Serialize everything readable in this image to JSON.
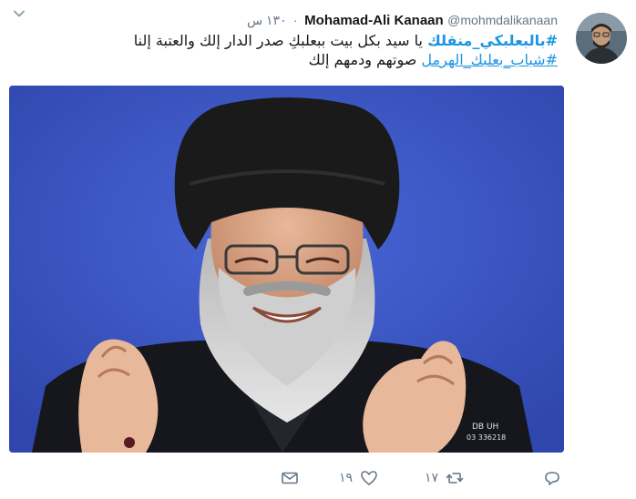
{
  "tweet": {
    "author_name": "Mohamad-Ali Kanaan",
    "author_handle": "@mohmdalikanaan",
    "separator": "·",
    "time": "١٣٠ س",
    "text": {
      "line1_hashtag": "#بالبعلبكي_منقلك",
      "line1_text": " يا سيد بكل بيت ببعلبكِ صدر الدار إلك والعتبة إلنا",
      "line2_hashtag": "#شباب_بعلبك_الهرمل",
      "line2_text": " صوتهم ودمهم إلك"
    },
    "media": {
      "watermark_line1": "DB UH",
      "watermark_line2": "03 336218"
    },
    "actions": {
      "retweet_count": "١٧",
      "like_count": "١٩"
    }
  },
  "icons": {
    "more": "chevron-down-icon",
    "reply": "reply-icon",
    "retweet": "retweet-icon",
    "like": "heart-icon",
    "message": "envelope-icon"
  },
  "colors": {
    "link": "#1b95e0",
    "secondary": "#657786",
    "media_background": "#3a55c4"
  }
}
